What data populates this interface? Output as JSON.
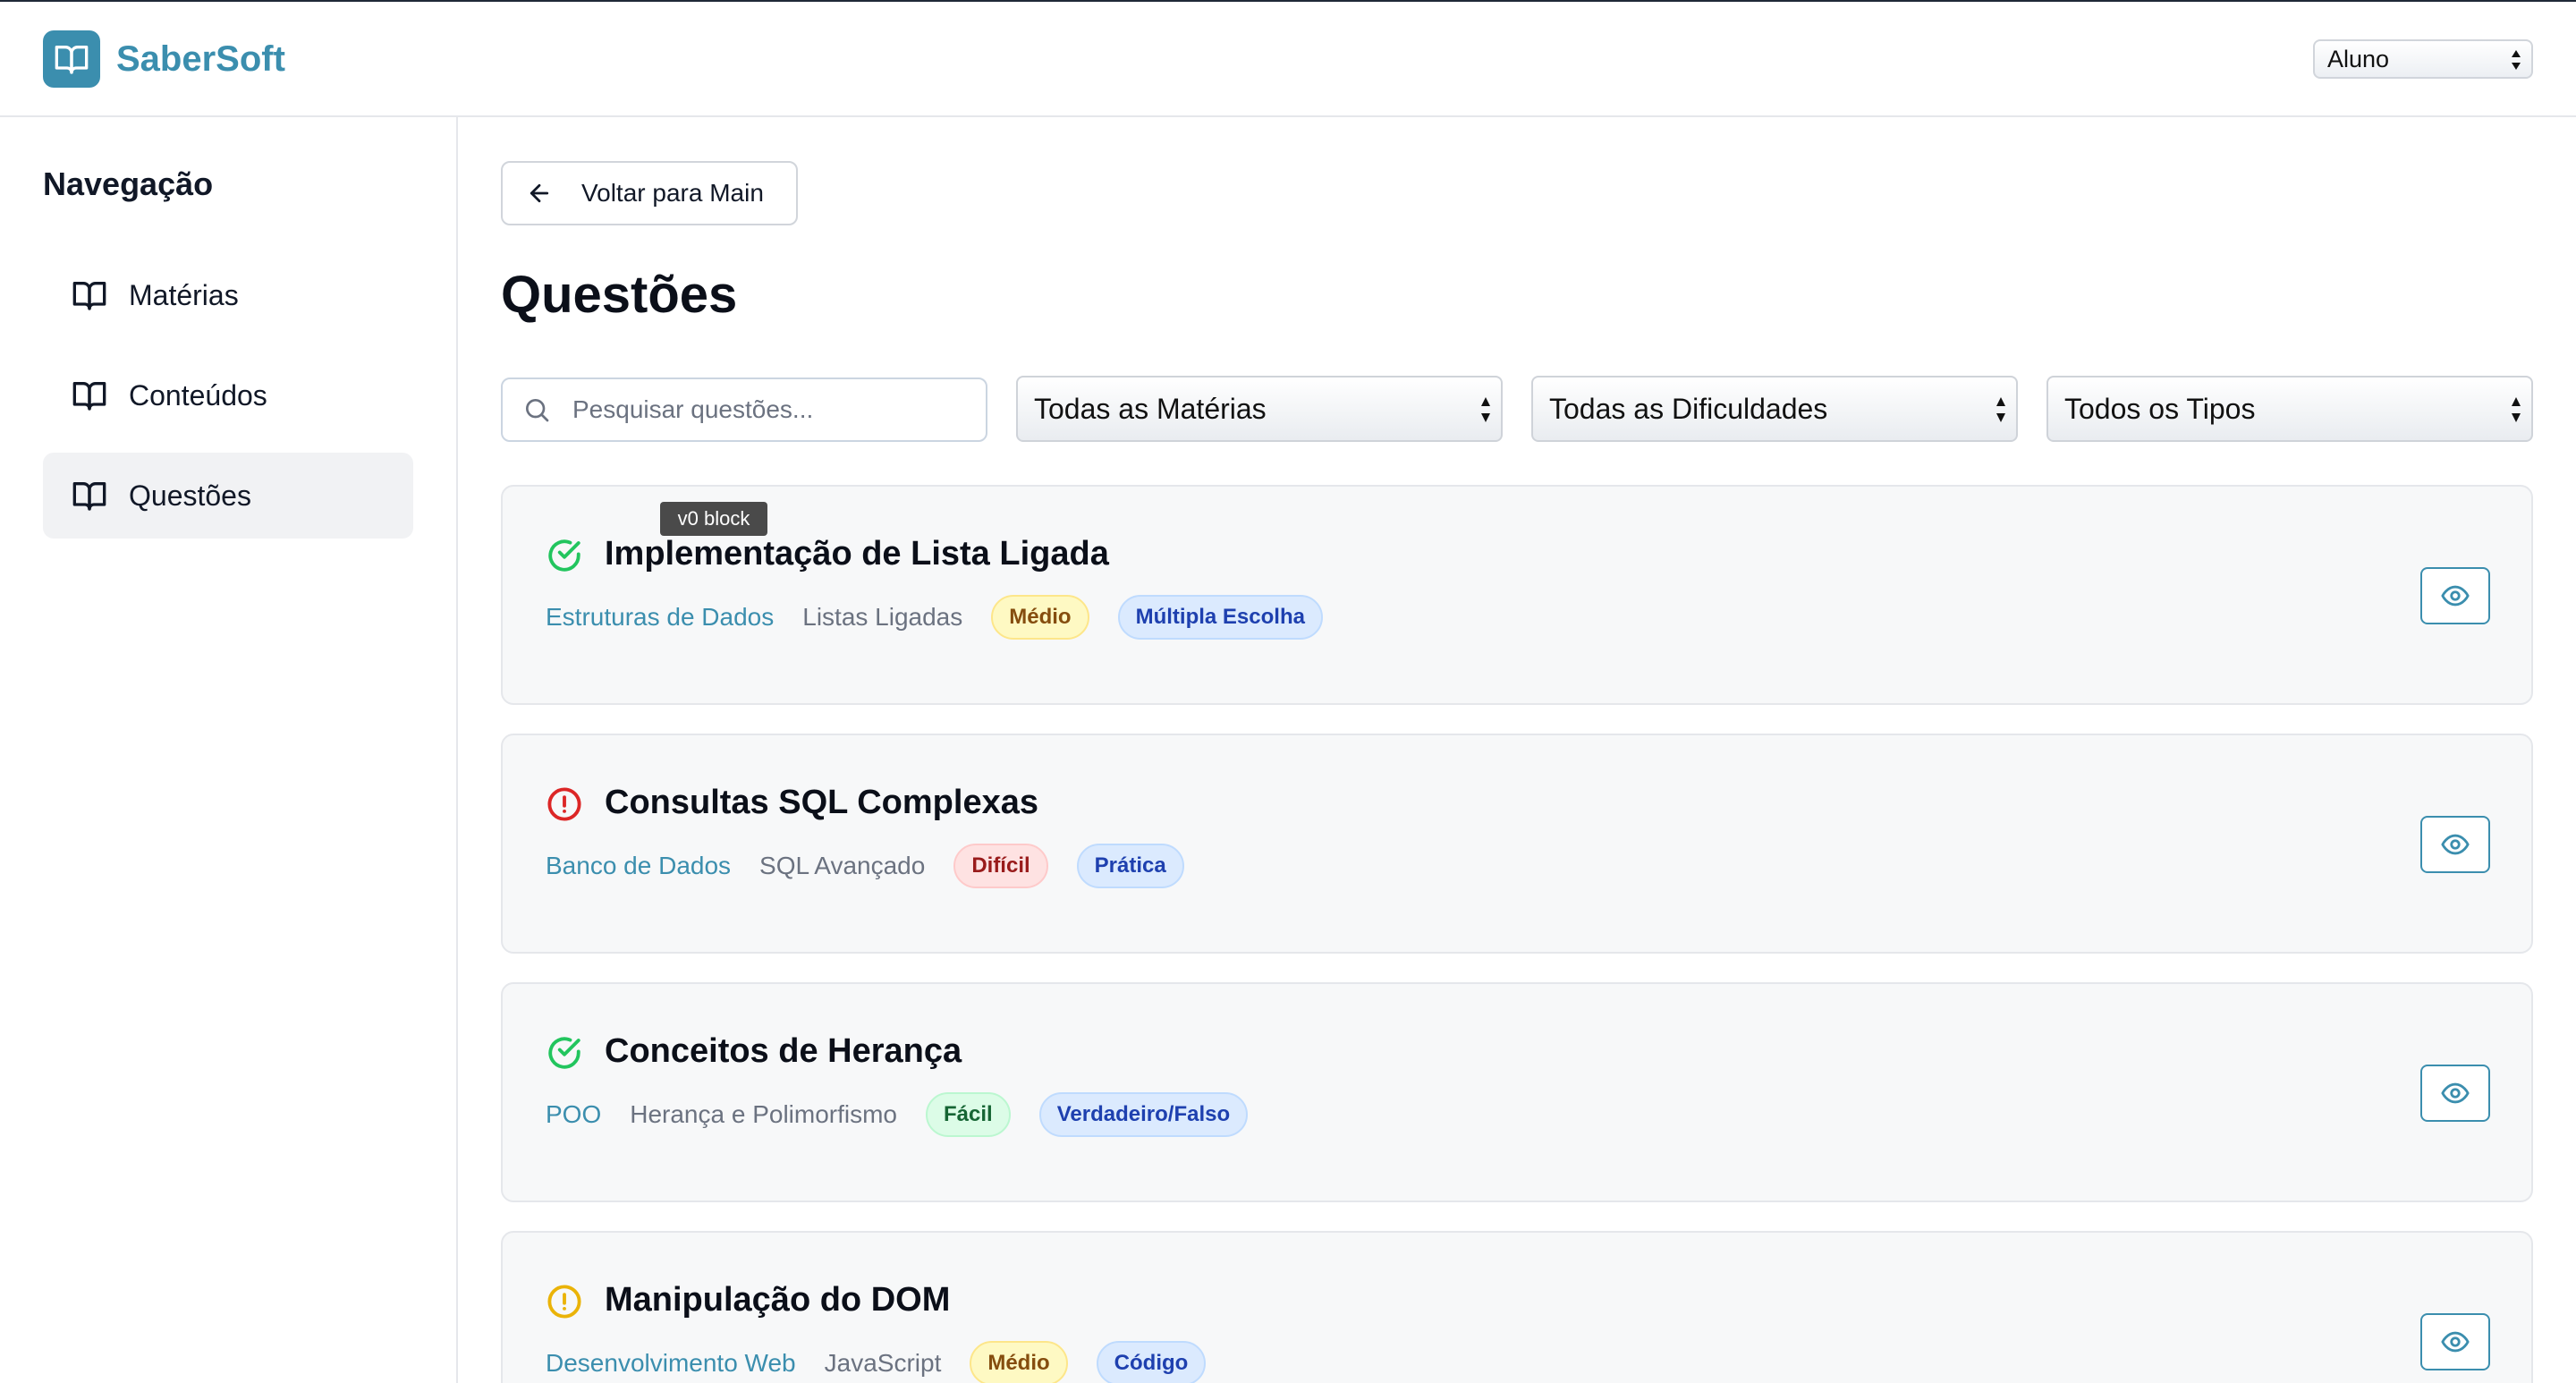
{
  "app": {
    "name": "SaberSoft",
    "logo_icon": "book-open-icon"
  },
  "header": {
    "role_select": {
      "value": "Aluno"
    }
  },
  "sidebar": {
    "title": "Navegação",
    "items": [
      {
        "label": "Matérias",
        "icon": "book-open-icon",
        "active": false
      },
      {
        "label": "Conteúdos",
        "icon": "book-open-icon",
        "active": false
      },
      {
        "label": "Questões",
        "icon": "book-open-icon",
        "active": true
      }
    ]
  },
  "main": {
    "back_label": "Voltar para Main",
    "title": "Questões",
    "search": {
      "placeholder": "Pesquisar questões..."
    },
    "filters": {
      "subject": "Todas as Matérias",
      "difficulty": "Todas as Dificuldades",
      "type": "Todos os Tipos"
    },
    "tooltip": "v0 block",
    "questions": [
      {
        "title": "Implementação de Lista Ligada",
        "subject": "Estruturas de Dados",
        "topic": "Listas Ligadas",
        "difficulty": "Médio",
        "type": "Múltipla Escolha",
        "status": "correct"
      },
      {
        "title": "Consultas SQL Complexas",
        "subject": "Banco de Dados",
        "topic": "SQL Avançado",
        "difficulty": "Difícil",
        "type": "Prática",
        "status": "error"
      },
      {
        "title": "Conceitos de Herança",
        "subject": "POO",
        "topic": "Herança e Polimorfismo",
        "difficulty": "Fácil",
        "type": "Verdadeiro/Falso",
        "status": "correct"
      },
      {
        "title": "Manipulação do DOM",
        "subject": "Desenvolvimento Web",
        "topic": "JavaScript",
        "difficulty": "Médio",
        "type": "Código",
        "status": "pending"
      }
    ]
  },
  "colors": {
    "brand": "#3b8eae",
    "correct": "#22c55e",
    "error": "#dc2626",
    "pending": "#eab308",
    "easy_bg": "#dcfce7",
    "easy_text": "#166534",
    "medium_bg": "#fef9c3",
    "medium_text": "#854d0e",
    "hard_bg": "#fee2e2",
    "hard_text": "#991b1b",
    "type_bg": "#dbeafe",
    "type_text": "#1e40af"
  }
}
